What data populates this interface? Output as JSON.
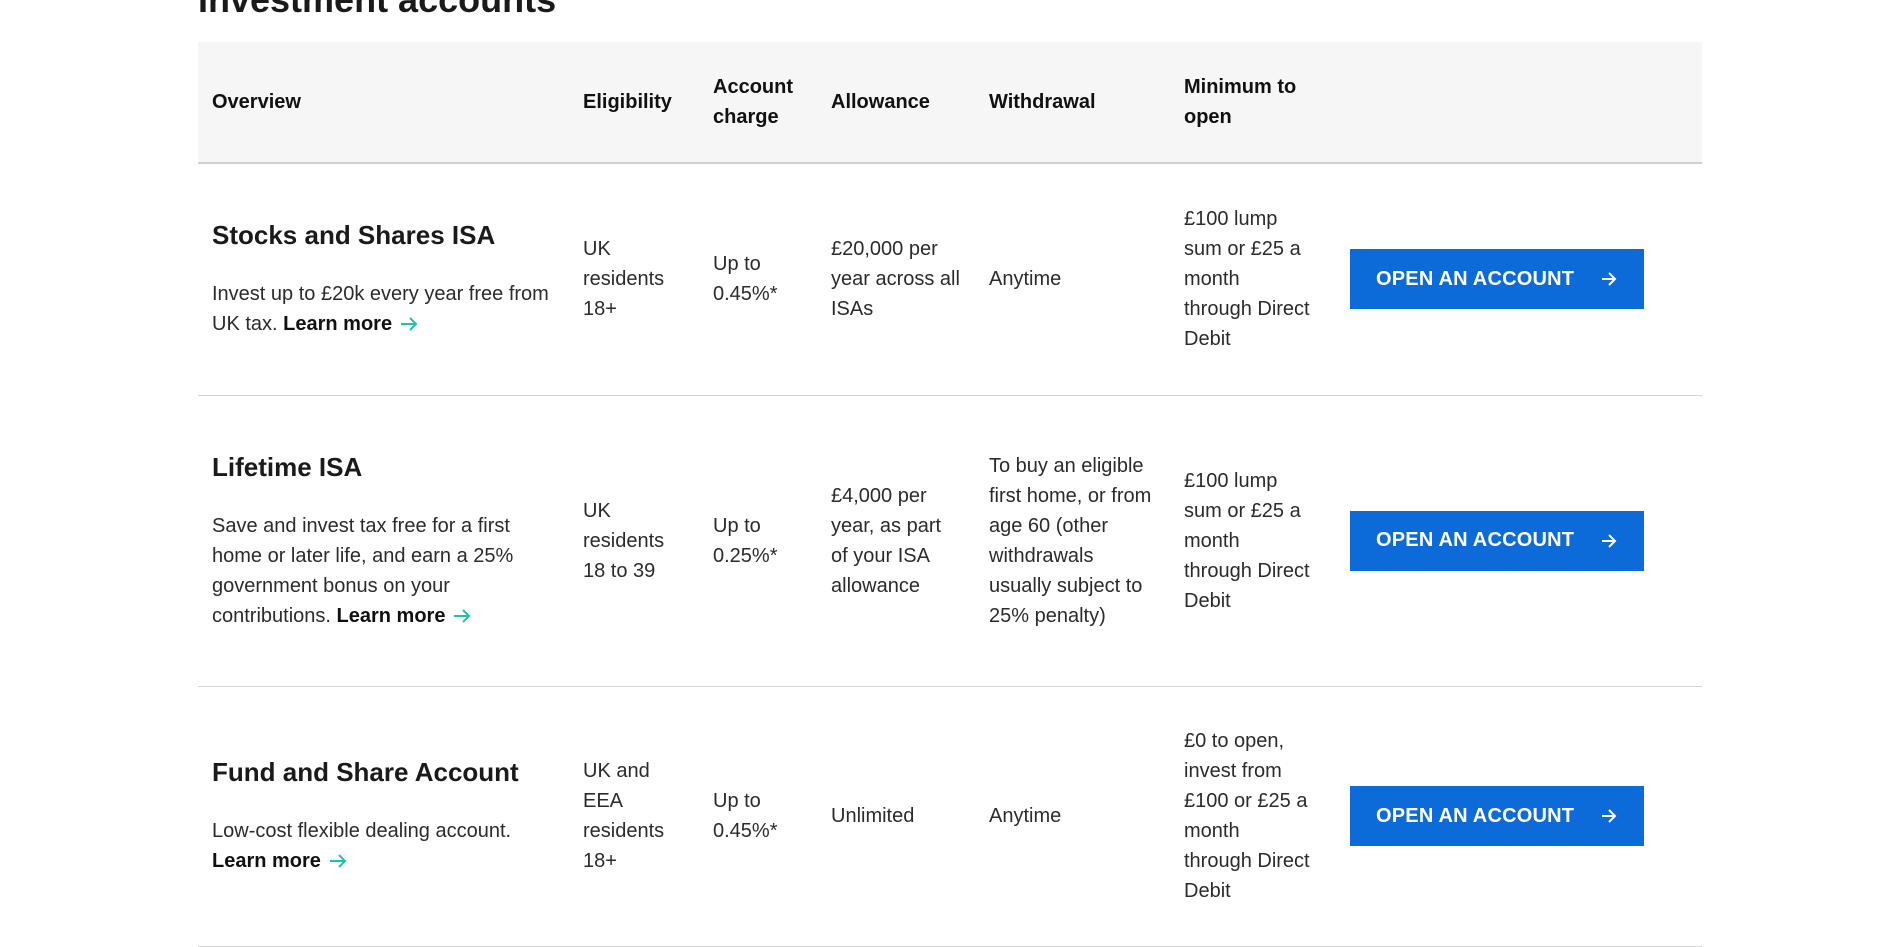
{
  "page": {
    "heading": "Investment accounts"
  },
  "table": {
    "headers": {
      "overview": "Overview",
      "eligibility": "Eligibility",
      "charge": "Account charge",
      "allowance": "Allowance",
      "withdrawal": "Withdrawal",
      "minimum": "Minimum to open"
    },
    "rows": [
      {
        "title": "Stocks and Shares ISA",
        "description": "Invest up to £20k every year free from UK tax.",
        "learn_more": "Learn more",
        "eligibility": "UK residents 18+",
        "charge": "Up to 0.45%*",
        "allowance": "£20,000 per year across all ISAs",
        "withdrawal": "Anytime",
        "minimum": "£100 lump sum or £25 a month through Direct Debit",
        "button": "OPEN AN ACCOUNT"
      },
      {
        "title": "Lifetime ISA",
        "description": "Save and invest tax free for a first home or later life, and earn a 25% government bonus on your contributions.",
        "learn_more": "Learn more",
        "eligibility": "UK residents 18 to 39",
        "charge": "Up to 0.25%*",
        "allowance": "£4,000 per year, as part of your ISA allowance",
        "withdrawal": "To buy an eligible first home, or from age 60 (other withdrawals usually subject to 25% penalty)",
        "minimum": "£100 lump sum or £25 a month through Direct Debit",
        "button": "OPEN AN ACCOUNT"
      },
      {
        "title": "Fund and Share Account",
        "description": "Low-cost flexible dealing account.",
        "learn_more": "Learn more",
        "eligibility": "UK and EEA residents 18+",
        "charge": "Up to 0.45%*",
        "allowance": "Unlimited",
        "withdrawal": "Anytime",
        "minimum": "£0 to open, invest from £100 or £25 a month through Direct Debit",
        "button": "OPEN AN ACCOUNT"
      }
    ]
  },
  "colors": {
    "button": "#0d6ad9",
    "link_arrow": "#1fc4a6",
    "header_bg": "#f6f6f6"
  },
  "icons": {
    "learn_more": "arrow-right-icon",
    "button": "arrow-right-icon"
  }
}
